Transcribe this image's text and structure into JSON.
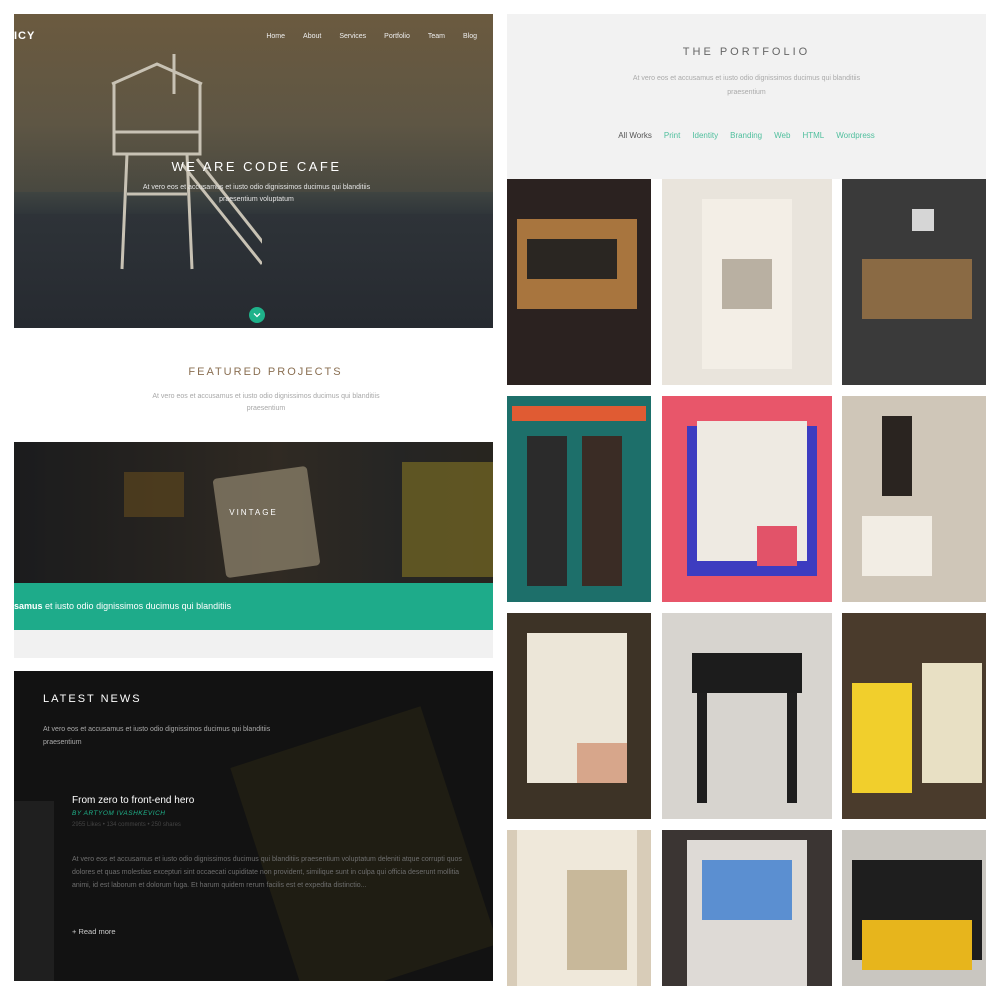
{
  "hero": {
    "logo": "ICY",
    "nav": [
      "Home",
      "About",
      "Services",
      "Portfolio",
      "Team",
      "Blog"
    ],
    "title": "WE ARE CODE CAFE",
    "subtitle": "At vero eos et accusamus et iusto odio dignissimos ducimus qui blanditiis praesentium voluptatum"
  },
  "featured": {
    "title": "FEATURED PROJECTS",
    "subtitle": "At vero eos et accusamus et iusto odio dignissimos ducimus qui blanditiis praesentium",
    "slide_label": "VINTAGE",
    "caption_bold": "samus",
    "caption_rest": " et iusto odio dignissimos ducimus qui blanditiis"
  },
  "news": {
    "title": "LATEST NEWS",
    "subtitle": "At vero eos et accusamus et iusto odio dignissimos ducimus qui blanditiis praesentium",
    "post": {
      "title": "From zero to front-end hero",
      "author": "BY ARTYOM IVASHKEVICH",
      "meta": "2955 Likes  •  134 comments  •  250 shares",
      "body": "At vero eos et accusamus et iusto odio dignissimos ducimus qui blanditiis praesentium voluptatum deleniti atque corrupti quos dolores et quas molestias excepturi sint occaecati cupiditate non provident, similique sunt in culpa qui officia deserunt mollitia animi, id est laborum et dolorum fuga. Et harum quidem rerum facilis est et expedita distinctio...",
      "read_more": "+ Read more"
    }
  },
  "portfolio": {
    "title": "THE PORTFOLIO",
    "subtitle": "At vero eos et accusamus et iusto odio dignissimos ducimus qui blanditiis praesentium",
    "filters": [
      "All Works",
      "Print",
      "Identity",
      "Branding",
      "Web",
      "HTML",
      "Wordpress"
    ],
    "active_filter": "All Works",
    "items": [
      {
        "name": "wooden-drawer",
        "bg": "#2b2220"
      },
      {
        "name": "tours-bag",
        "bg": "#e9e4dc"
      },
      {
        "name": "nightstand",
        "bg": "#3a3a3a"
      },
      {
        "name": "beer-box",
        "bg": "#1d6f6a"
      },
      {
        "name": "book-mockup",
        "bg": "#e8566a"
      },
      {
        "name": "bottle-plate",
        "bg": "#cfc6b8"
      },
      {
        "name": "dust-jacket",
        "bg": "#3d3326"
      },
      {
        "name": "stool",
        "bg": "#d7d4cf"
      },
      {
        "name": "garbeo-bags",
        "bg": "#4a3b2c"
      },
      {
        "name": "tours-bag-2",
        "bg": "#d8ccb8"
      },
      {
        "name": "tablet",
        "bg": "#3b3533"
      },
      {
        "name": "book-box",
        "bg": "#c9c6c0"
      }
    ]
  },
  "colors": {
    "accent": "#1fb28a",
    "portfolio_filter": "#4fbf9d"
  }
}
